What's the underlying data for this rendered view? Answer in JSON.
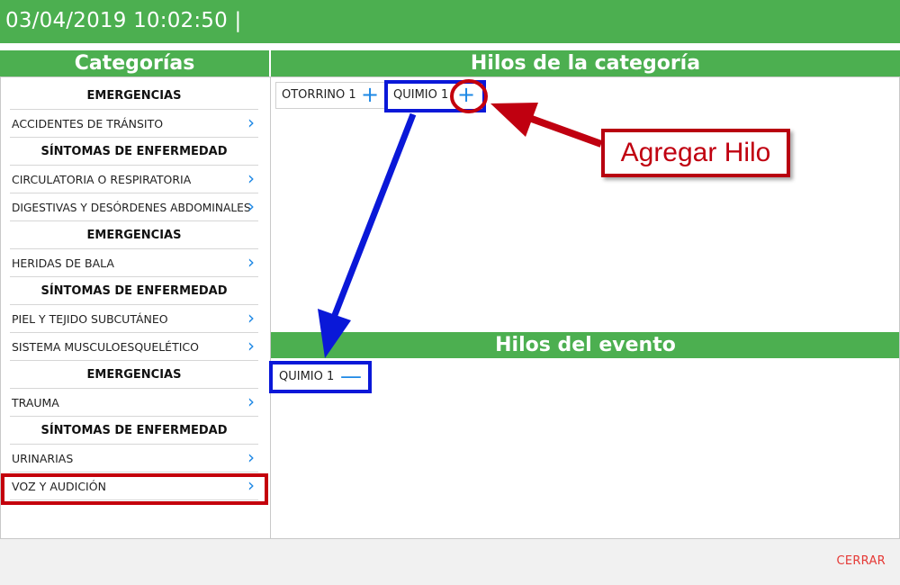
{
  "topbar": {
    "datetime": "03/04/2019 10:02:50 |"
  },
  "categories_panel": {
    "title": "Categorías",
    "items": [
      {
        "type": "heading",
        "label": "EMERGENCIAS"
      },
      {
        "type": "item",
        "label": "ACCIDENTES DE TRÁNSITO"
      },
      {
        "type": "heading",
        "label": "SÍNTOMAS DE ENFERMEDAD"
      },
      {
        "type": "item",
        "label": "CIRCULATORIA O RESPIRATORIA"
      },
      {
        "type": "item",
        "label": "DIGESTIVAS Y DESÓRDENES ABDOMINALES"
      },
      {
        "type": "heading",
        "label": "EMERGENCIAS"
      },
      {
        "type": "item",
        "label": "HERIDAS DE BALA"
      },
      {
        "type": "heading",
        "label": "SÍNTOMAS DE ENFERMEDAD"
      },
      {
        "type": "item",
        "label": "PIEL Y TEJIDO SUBCUTÁNEO"
      },
      {
        "type": "item",
        "label": "SISTEMA MUSCULOESQUELÉTICO"
      },
      {
        "type": "heading",
        "label": "EMERGENCIAS"
      },
      {
        "type": "item",
        "label": "TRAUMA"
      },
      {
        "type": "heading",
        "label": "SÍNTOMAS DE ENFERMEDAD"
      },
      {
        "type": "item",
        "label": "URINARIAS"
      },
      {
        "type": "item",
        "label": "VOZ Y AUDICIÓN"
      }
    ],
    "chevron_icon": "chevron-right-icon"
  },
  "category_threads": {
    "title": "Hilos de la categoría",
    "threads": [
      {
        "label": "OTORRINO 1",
        "action": "+"
      },
      {
        "label": "QUIMIO 1",
        "action": "+"
      }
    ]
  },
  "event_threads": {
    "title": "Hilos del evento",
    "threads": [
      {
        "label": "QUIMIO 1",
        "action": "—"
      }
    ]
  },
  "annotation": {
    "label": "Agregar Hilo"
  },
  "footer": {
    "close_label": "CERRAR"
  },
  "colors": {
    "header_green": "#4caf50",
    "accent_blue": "#1e88e5",
    "close_red": "#e53935",
    "highlight_blue": "#0a18d8",
    "highlight_red": "#c4000c"
  }
}
